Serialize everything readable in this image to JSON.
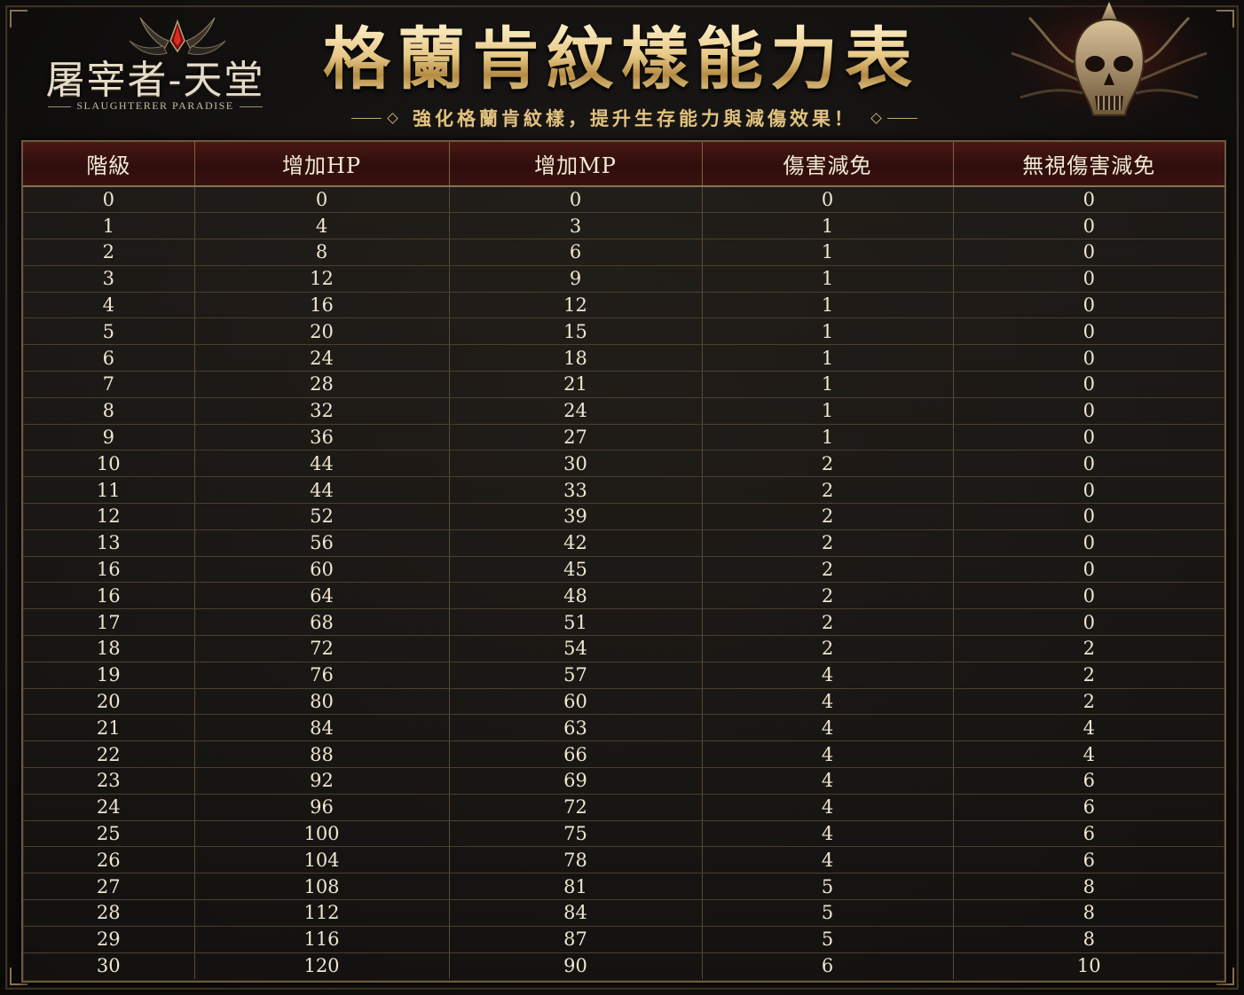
{
  "logo": {
    "title": "屠宰者-天堂",
    "subtitle": "SLAUGHTERER PARADISE"
  },
  "header": {
    "title": "格蘭肯紋樣能力表",
    "subtitle": "強化格蘭肯紋樣，提升生存能力與減傷效果！"
  },
  "colors": {
    "accent_gold": "#e2c27f",
    "header_red": "#4a1714",
    "background": "#141210"
  },
  "table": {
    "columns": [
      "階級",
      "增加HP",
      "增加MP",
      "傷害減免",
      "無視傷害減免"
    ],
    "rows": [
      [
        "0",
        "0",
        "0",
        "0",
        "0"
      ],
      [
        "1",
        "4",
        "3",
        "1",
        "0"
      ],
      [
        "2",
        "8",
        "6",
        "1",
        "0"
      ],
      [
        "3",
        "12",
        "9",
        "1",
        "0"
      ],
      [
        "4",
        "16",
        "12",
        "1",
        "0"
      ],
      [
        "5",
        "20",
        "15",
        "1",
        "0"
      ],
      [
        "6",
        "24",
        "18",
        "1",
        "0"
      ],
      [
        "7",
        "28",
        "21",
        "1",
        "0"
      ],
      [
        "8",
        "32",
        "24",
        "1",
        "0"
      ],
      [
        "9",
        "36",
        "27",
        "1",
        "0"
      ],
      [
        "10",
        "44",
        "30",
        "2",
        "0"
      ],
      [
        "11",
        "44",
        "33",
        "2",
        "0"
      ],
      [
        "12",
        "52",
        "39",
        "2",
        "0"
      ],
      [
        "13",
        "56",
        "42",
        "2",
        "0"
      ],
      [
        "16",
        "60",
        "45",
        "2",
        "0"
      ],
      [
        "16",
        "64",
        "48",
        "2",
        "0"
      ],
      [
        "17",
        "68",
        "51",
        "2",
        "0"
      ],
      [
        "18",
        "72",
        "54",
        "2",
        "2"
      ],
      [
        "19",
        "76",
        "57",
        "4",
        "2"
      ],
      [
        "20",
        "80",
        "60",
        "4",
        "2"
      ],
      [
        "21",
        "84",
        "63",
        "4",
        "4"
      ],
      [
        "22",
        "88",
        "66",
        "4",
        "4"
      ],
      [
        "23",
        "92",
        "69",
        "4",
        "6"
      ],
      [
        "24",
        "96",
        "72",
        "4",
        "6"
      ],
      [
        "25",
        "100",
        "75",
        "4",
        "6"
      ],
      [
        "26",
        "104",
        "78",
        "4",
        "6"
      ],
      [
        "27",
        "108",
        "81",
        "5",
        "8"
      ],
      [
        "28",
        "112",
        "84",
        "5",
        "8"
      ],
      [
        "29",
        "116",
        "87",
        "5",
        "8"
      ],
      [
        "30",
        "120",
        "90",
        "6",
        "10"
      ]
    ]
  }
}
